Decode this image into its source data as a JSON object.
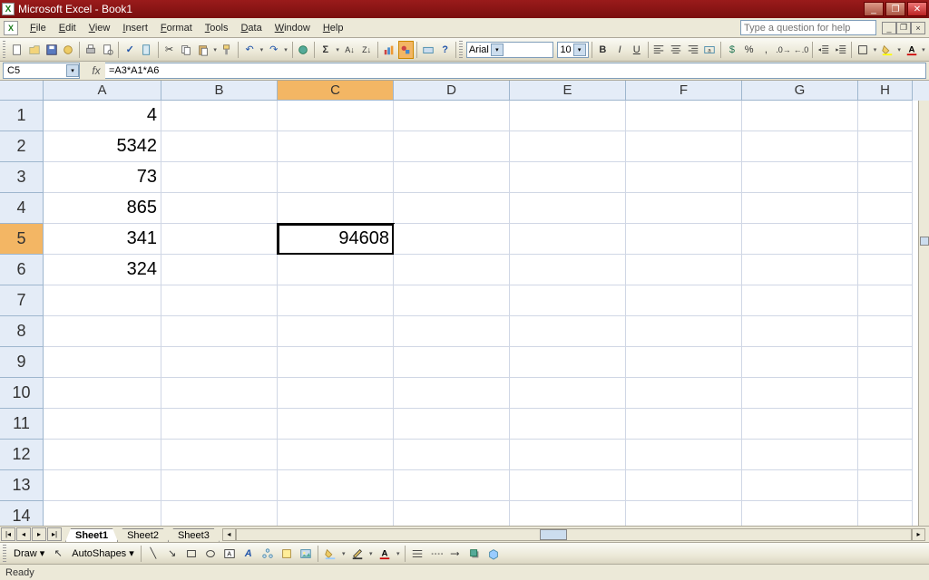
{
  "app": {
    "title": "Microsoft Excel - Book1"
  },
  "window_buttons": {
    "min": "_",
    "max": "❐",
    "close": "✕"
  },
  "menu": {
    "items": [
      "File",
      "Edit",
      "View",
      "Insert",
      "Format",
      "Tools",
      "Data",
      "Window",
      "Help"
    ],
    "help_placeholder": "Type a question for help"
  },
  "doc_buttons": {
    "min": "_",
    "restore": "❐",
    "close": "×"
  },
  "formatting": {
    "font": "Arial",
    "size": "10",
    "bold": "B",
    "italic": "I",
    "underline": "U"
  },
  "formula_bar": {
    "name_box": "C5",
    "fx_label": "fx",
    "formula": "=A3*A1*A6"
  },
  "grid": {
    "columns": [
      {
        "label": "A",
        "width": 130
      },
      {
        "label": "B",
        "width": 128
      },
      {
        "label": "C",
        "width": 128
      },
      {
        "label": "D",
        "width": 128
      },
      {
        "label": "E",
        "width": 128
      },
      {
        "label": "F",
        "width": 128
      },
      {
        "label": "G",
        "width": 128
      },
      {
        "label": "H",
        "width": 60
      }
    ],
    "selected_col": 2,
    "selected_row": 4,
    "row_count": 14,
    "cells": {
      "A1": "4",
      "A2": "5342",
      "A3": "73",
      "A4": "865",
      "A5": "341",
      "A6": "324",
      "C5": "94608"
    }
  },
  "sheet_tabs": {
    "tabs": [
      "Sheet1",
      "Sheet2",
      "Sheet3"
    ],
    "active": 0
  },
  "draw_toolbar": {
    "draw_label": "Draw ▾",
    "autoshapes_label": "AutoShapes ▾"
  },
  "status": {
    "text": "Ready"
  }
}
